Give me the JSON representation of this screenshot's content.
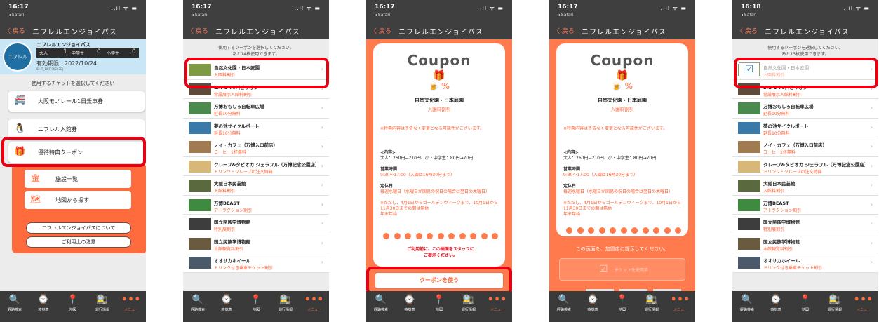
{
  "status": {
    "time_a": "16:17",
    "time_b": "16:18",
    "back_app": "◂ Safari",
    "signal": "..ıl ᯤ ▬"
  },
  "nav": {
    "back": "〈 戻る",
    "title": "ニフレルエンジョイパス"
  },
  "tabs": [
    {
      "icon": "🔍",
      "icon_name": "search-icon",
      "label": "経路検索"
    },
    {
      "icon": "⌚",
      "icon_name": "timetable-icon",
      "label": "時刻表"
    },
    {
      "icon": "📍",
      "icon_name": "map-pin-icon",
      "label": "地図"
    },
    {
      "icon": "🚉",
      "icon_name": "live-info-icon",
      "label": "運行情報"
    },
    {
      "icon": "•••",
      "icon_name": "more-icon",
      "label": "メニュー"
    }
  ],
  "pass": {
    "logo": "ニフレル",
    "name": "ニフレルエンジョイパス",
    "adult_label": "大人",
    "adult_count": "1",
    "junior_label": "中学生",
    "junior_count": "0",
    "child_label": "小学生",
    "child_count": "0",
    "expiry": "有効期限：2022/10/24",
    "id": "ID: T_10JTJ9KE63DJ"
  },
  "select_ticket": "使用するチケットを選択してください",
  "tickets": [
    {
      "icon": "🚝",
      "label": "大阪モノレール1日乗車券"
    },
    {
      "icon": "🐧",
      "label": "ニフレル入館券"
    },
    {
      "icon": "🎁",
      "label": "優待特典クーポン"
    }
  ],
  "coupon_menu": [
    {
      "icon": "🏛",
      "label": "施設一覧"
    },
    {
      "icon": "🗺",
      "label": "地図から探す"
    }
  ],
  "links": [
    "ニフレルエンジョイパスについて",
    "ご利用上の注意"
  ],
  "list_header_a": [
    "使用するクーポンを選択してください。",
    "あと14枚使用できます。"
  ],
  "list_header_b": [
    "使用するクーポンを選択してください。",
    "あと13枚使用できます。"
  ],
  "coupons": [
    {
      "name": "自然文化園・日本庭園",
      "sub": "入園料割引",
      "color": "#7f9a45"
    },
    {
      "name": "EXPO'70パビリオン",
      "sub": "常設展示入館料割引",
      "color": "#5d4a3b"
    },
    {
      "name": "万博おもしろ自転車広場",
      "sub": "延長10分無料",
      "color": "#4a8a4f"
    },
    {
      "name": "夢の池サイクルボート",
      "sub": "延長10分無料",
      "color": "#3a7aa8"
    },
    {
      "name": "ノイ・カフェ（万博入口前店）",
      "sub": "コーヒー1杯無料",
      "color": "#a07a50"
    },
    {
      "name": "クレープ&タピオカ ジェラフル（万博記念公園店）",
      "sub": "ドリンク・クレープの注文特典",
      "color": "#d8b878"
    },
    {
      "name": "大阪日本民芸館",
      "sub": "入館料割引",
      "color": "#5a6a3e"
    },
    {
      "name": "万博BEAST",
      "sub": "アトラクション割引",
      "color": "#3e8a3e"
    },
    {
      "name": "国立民族学博物館",
      "sub": "特別展割引",
      "color": "#3d3d3d"
    },
    {
      "name": "国立民族学博物館",
      "sub": "本館観覧料割引",
      "color": "#6a5a40"
    },
    {
      "name": "オオサカホイール",
      "sub": "ドリンク付き乗車チケット割引",
      "color": "#4a5a6a"
    }
  ],
  "detail": {
    "coupon_word": "Coupon",
    "gift_icon": "🎁",
    "beer_icon": "🍺 %",
    "name": "自然文化園・日本庭園",
    "discount": "入園料割引",
    "change_notice": "※特典内容は予告なく変更となる可能性がございます。",
    "content_label": "<内容>",
    "content_value": "大人：260円→210円、小・中学生：80円→70円",
    "hours_label": "営業時間",
    "hours_value": "9:30～17:00（入園は16時30分まで）",
    "closed_label": "定休日",
    "closed_1": "毎週水曜日（水曜日が国民の祝日の場合は翌日の木曜日）",
    "closed_2": "※ただし、4月1日からゴールデンウィークまで、10月1日から11月30日までの間は無休",
    "closed_3": "年末年始",
    "staff_notice_1": "ご利用前に、この画面をスタッフに",
    "staff_notice_2": "ご提示ください。",
    "use_button": "クーポンを使う",
    "present": "この画面を、加盟店に提示してください。",
    "used_icon": "☑",
    "used_label": "チケットを使用済"
  }
}
